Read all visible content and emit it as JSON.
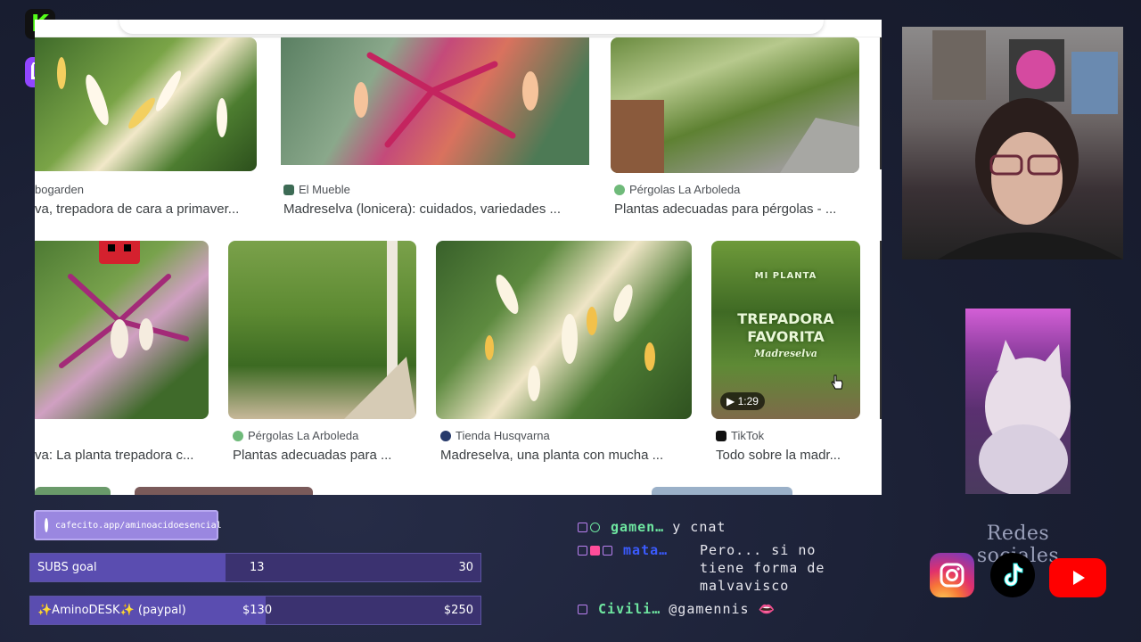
{
  "stream": {
    "platform_icons": [
      "kick-icon",
      "twitch-icon"
    ],
    "kick_letter": "K"
  },
  "browser": {
    "row1": [
      {
        "source": "bogarden",
        "title": "va, trepadora de cara a primaver..."
      },
      {
        "source": "El Mueble",
        "title": "Madreselva (lonicera): cuidados, variedades ..."
      },
      {
        "source": "Pérgolas La Arboleda",
        "title": "Plantas adecuadas para pérgolas - ..."
      }
    ],
    "row2": [
      {
        "source": "",
        "title": "va: La planta trepadora c..."
      },
      {
        "source": "Pérgolas La Arboleda",
        "title": "Plantas adecuadas para ..."
      },
      {
        "source": "Tienda Husqvarna",
        "title": "Madreselva, una planta con mucha ..."
      },
      {
        "source": "TikTok",
        "title": "Todo sobre la madr..."
      }
    ],
    "video": {
      "overlay_top": "MI PLANTA",
      "overlay_mid1": "TREPADORA",
      "overlay_mid2": "FAVORITA",
      "overlay_sub": "Madreselva",
      "duration": "1:29"
    }
  },
  "sidebar": {
    "redes_title": "Redes sociales",
    "socials": [
      "instagram-icon",
      "tiktok-icon",
      "youtube-icon"
    ]
  },
  "donations": {
    "cafecito_url": "cafecito.app/aminoacidoesencial",
    "subs_goal": {
      "label": "SUBS goal",
      "current": "13",
      "max": "30",
      "progress": 0.433
    },
    "desk_goal": {
      "label": "✨AminoDESK✨ (paypal)",
      "current": "$130",
      "max": "$250",
      "progress": 0.52
    }
  },
  "chat": {
    "messages": [
      {
        "user": "gamen…",
        "text": "y cnat",
        "user_color": "#6ee6a0"
      },
      {
        "user": "mata…",
        "text_lines": [
          "Pero... si no",
          "tiene forma de",
          "malvavisco"
        ],
        "user_color": "#3b5bff"
      },
      {
        "user": "Civili…",
        "text": "@gamennis 👄",
        "user_color": "#6ee6a0"
      }
    ]
  },
  "colors": {
    "overlay_bg": "#1d2236",
    "goal_fill": "#5a4db0",
    "cafecito": "#9a87e0",
    "twitch": "#9146ff",
    "kick": "#53fc18"
  }
}
